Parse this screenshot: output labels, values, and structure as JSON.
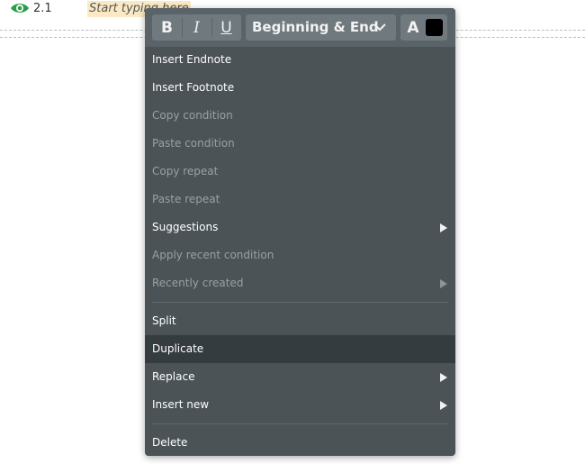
{
  "document": {
    "section_number": "2.1",
    "placeholder": "Start typing here",
    "icon_color": "#2a9d4a"
  },
  "toolbar": {
    "bold_label": "B",
    "italic_label": "I",
    "underline_label": "U",
    "format_select": "Beginning & End",
    "text_color_label": "A",
    "text_color_value": "#000000"
  },
  "menu": {
    "items": [
      {
        "label": "Insert Endnote"
      },
      {
        "label": "Insert Footnote"
      },
      {
        "label": "Copy condition"
      },
      {
        "label": "Paste condition"
      },
      {
        "label": "Copy repeat"
      },
      {
        "label": "Paste repeat"
      },
      {
        "label": "Suggestions"
      },
      {
        "label": "Apply recent condition"
      },
      {
        "label": "Recently created"
      },
      {
        "label": "Split"
      },
      {
        "label": "Duplicate"
      },
      {
        "label": "Replace"
      },
      {
        "label": "Insert new"
      },
      {
        "label": "Delete"
      }
    ]
  }
}
